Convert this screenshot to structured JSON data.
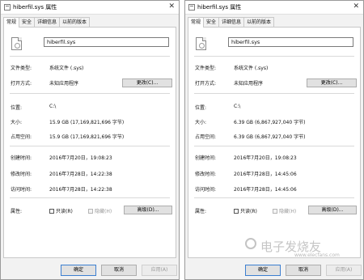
{
  "left": {
    "title": "hiberfil.sys 属性",
    "tabs": [
      "常规",
      "安全",
      "详细信息",
      "以前的版本"
    ],
    "filename": "hiberfil.sys",
    "file_type_label": "文件类型:",
    "file_type": "系统文件 (.sys)",
    "open_with_label": "打开方式:",
    "open_with": "未知应用程序",
    "change_button": "更改(C)...",
    "location_label": "位置:",
    "location": "C:\\",
    "size_label": "大小:",
    "size": "15.9 GB (17,169,821,696 字节)",
    "size_on_disk_label": "占用空间:",
    "size_on_disk": "15.9 GB (17,169,821,696 字节)",
    "created_label": "创建时间:",
    "created": "2016年7月20日，19:08:23",
    "modified_label": "修改时间:",
    "modified": "2016年7月28日，14:22:38",
    "accessed_label": "访问时间:",
    "accessed": "2016年7月28日，14:22:38",
    "attributes_label": "属性:",
    "readonly_label": "只读(R)",
    "hidden_label": "隐藏(H)",
    "advanced_button": "高级(D)...",
    "ok_button": "确定",
    "cancel_button": "取消",
    "apply_button": "应用(A)"
  },
  "right": {
    "title": "hiberfil.sys 属性",
    "tabs": [
      "常规",
      "安全",
      "详细信息",
      "以前的版本"
    ],
    "filename": "hiberfil.sys",
    "file_type_label": "文件类型:",
    "file_type": "系统文件 (.sys)",
    "open_with_label": "打开方式:",
    "open_with": "未知应用程序",
    "change_button": "更改(C)...",
    "location_label": "位置:",
    "location": "C:\\",
    "size_label": "大小:",
    "size": "6.39 GB (6,867,927,040 字节)",
    "size_on_disk_label": "占用空间:",
    "size_on_disk": "6.39 GB (6,867,927,040 字节)",
    "created_label": "创建时间:",
    "created": "2016年7月20日，19:08:23",
    "modified_label": "修改时间:",
    "modified": "2016年7月28日，14:45:06",
    "accessed_label": "访问时间:",
    "accessed": "2016年7月28日，14:45:06",
    "attributes_label": "属性:",
    "readonly_label": "只读(R)",
    "hidden_label": "隐藏(H)",
    "advanced_button": "高级(D)...",
    "ok_button": "确定",
    "cancel_button": "取消",
    "apply_button": "应用(A)"
  },
  "watermark": {
    "text": "电子发烧友",
    "url": "www.elecfans.com"
  }
}
